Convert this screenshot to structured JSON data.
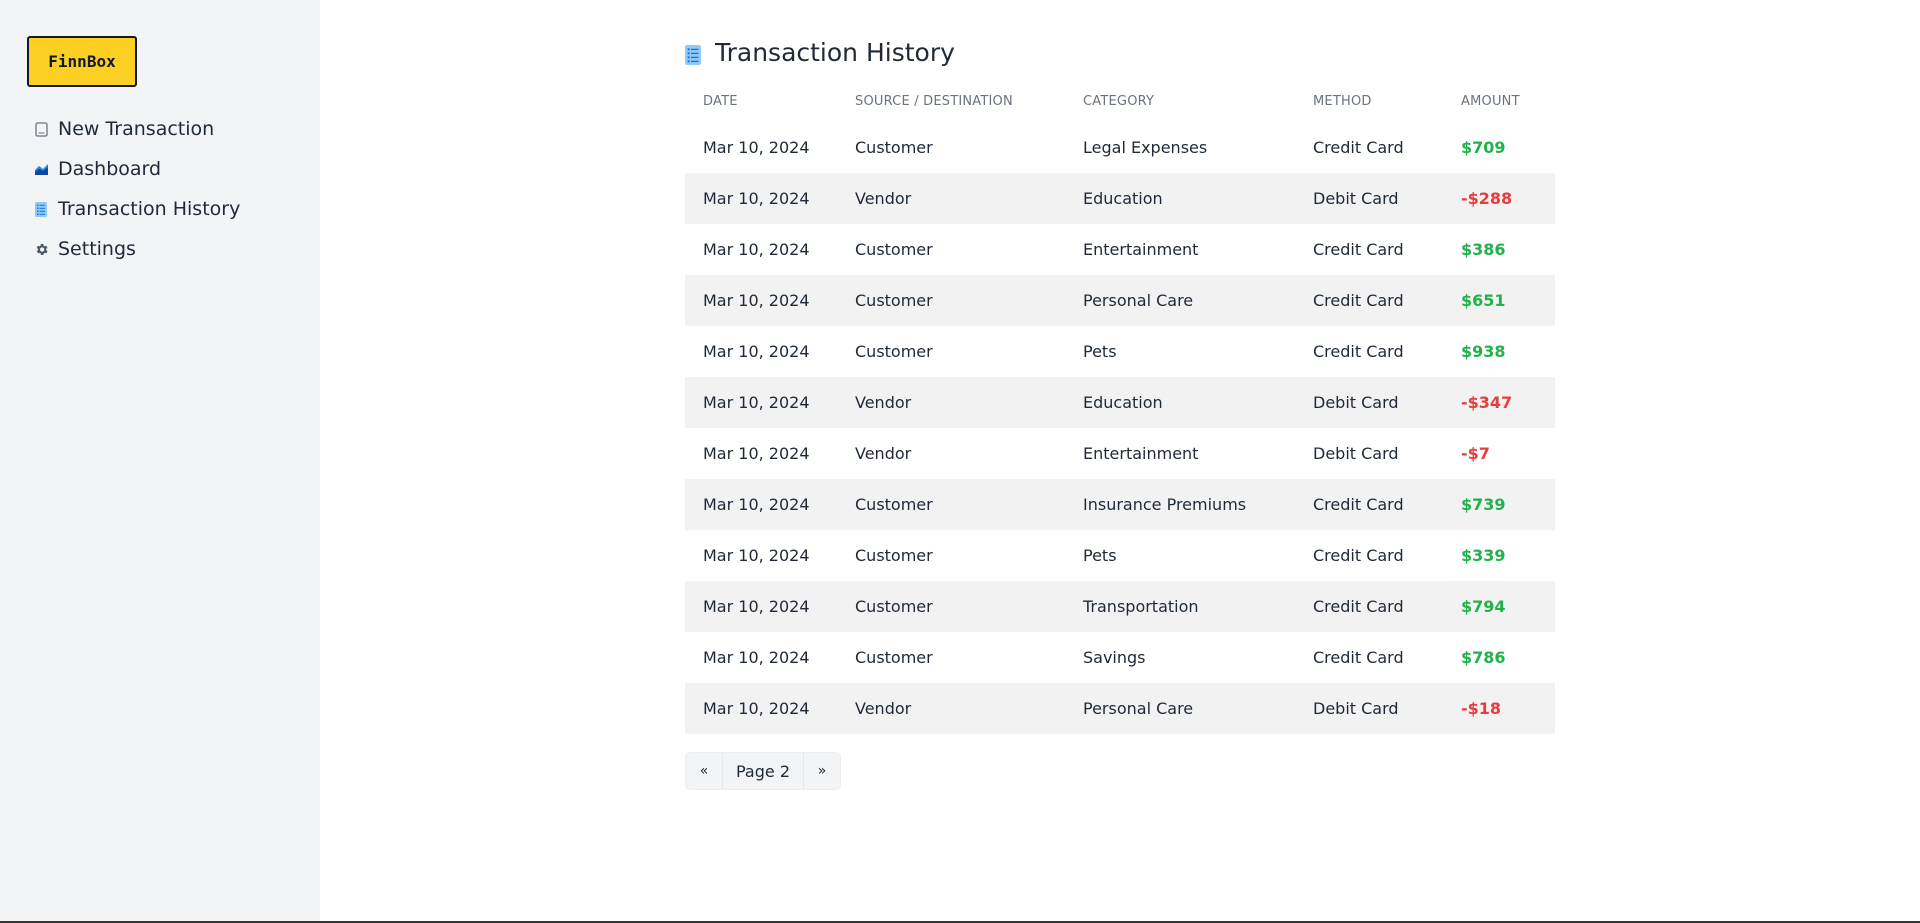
{
  "brand": {
    "name": "FinnBox"
  },
  "sidebar": {
    "items": [
      {
        "label": "New Transaction",
        "icon": "receipt-icon"
      },
      {
        "label": "Dashboard",
        "icon": "chart-icon"
      },
      {
        "label": "Transaction History",
        "icon": "list-icon"
      },
      {
        "label": "Settings",
        "icon": "gear-icon"
      }
    ]
  },
  "page": {
    "title": "Transaction History",
    "icon": "list-icon"
  },
  "table": {
    "columns": [
      "DATE",
      "SOURCE / DESTINATION",
      "CATEGORY",
      "METHOD",
      "AMOUNT"
    ],
    "rows": [
      {
        "date": "Mar 10, 2024",
        "party": "Customer",
        "category": "Legal Expenses",
        "method": "Credit Card",
        "amount": "$709",
        "sign": "pos"
      },
      {
        "date": "Mar 10, 2024",
        "party": "Vendor",
        "category": "Education",
        "method": "Debit Card",
        "amount": "-$288",
        "sign": "neg"
      },
      {
        "date": "Mar 10, 2024",
        "party": "Customer",
        "category": "Entertainment",
        "method": "Credit Card",
        "amount": "$386",
        "sign": "pos"
      },
      {
        "date": "Mar 10, 2024",
        "party": "Customer",
        "category": "Personal Care",
        "method": "Credit Card",
        "amount": "$651",
        "sign": "pos"
      },
      {
        "date": "Mar 10, 2024",
        "party": "Customer",
        "category": "Pets",
        "method": "Credit Card",
        "amount": "$938",
        "sign": "pos"
      },
      {
        "date": "Mar 10, 2024",
        "party": "Vendor",
        "category": "Education",
        "method": "Debit Card",
        "amount": "-$347",
        "sign": "neg"
      },
      {
        "date": "Mar 10, 2024",
        "party": "Vendor",
        "category": "Entertainment",
        "method": "Debit Card",
        "amount": "-$7",
        "sign": "neg"
      },
      {
        "date": "Mar 10, 2024",
        "party": "Customer",
        "category": "Insurance Premiums",
        "method": "Credit Card",
        "amount": "$739",
        "sign": "pos"
      },
      {
        "date": "Mar 10, 2024",
        "party": "Customer",
        "category": "Pets",
        "method": "Credit Card",
        "amount": "$339",
        "sign": "pos"
      },
      {
        "date": "Mar 10, 2024",
        "party": "Customer",
        "category": "Transportation",
        "method": "Credit Card",
        "amount": "$794",
        "sign": "pos"
      },
      {
        "date": "Mar 10, 2024",
        "party": "Customer",
        "category": "Savings",
        "method": "Credit Card",
        "amount": "$786",
        "sign": "pos"
      },
      {
        "date": "Mar 10, 2024",
        "party": "Vendor",
        "category": "Personal Care",
        "method": "Debit Card",
        "amount": "-$18",
        "sign": "neg"
      }
    ]
  },
  "pagination": {
    "prev": "«",
    "label": "Page 2",
    "next": "»"
  },
  "colors": {
    "accent": "#fcd022",
    "positive": "#22b24c",
    "negative": "#e53e3e",
    "sidebar_bg": "#f3f4f6",
    "row_alt": "#f2f2f2"
  }
}
